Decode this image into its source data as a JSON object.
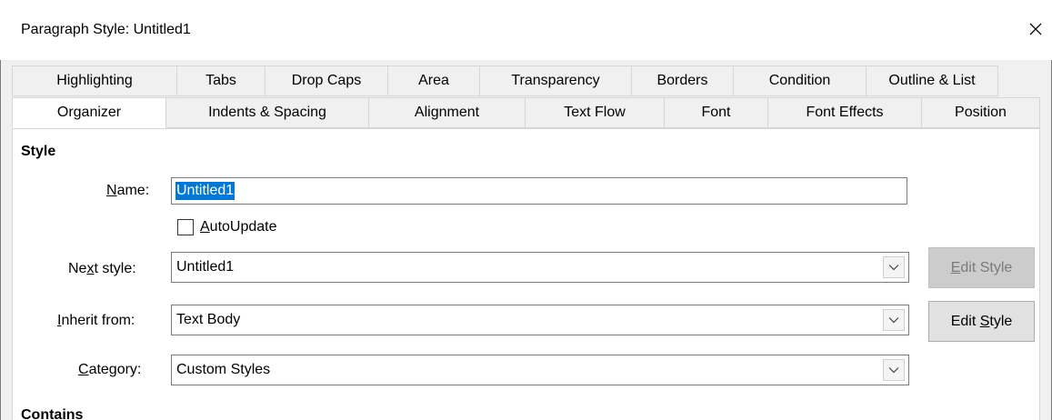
{
  "window": {
    "title": "Paragraph Style: Untitled1",
    "close_glyph": "close-icon"
  },
  "tabs": {
    "row1": [
      "Highlighting",
      "Tabs",
      "Drop Caps",
      "Area",
      "Transparency",
      "Borders",
      "Condition",
      "Outline & List"
    ],
    "row2": [
      "Organizer",
      "Indents & Spacing",
      "Alignment",
      "Text Flow",
      "Font",
      "Font Effects",
      "Position"
    ],
    "active": "Organizer"
  },
  "style_section": {
    "heading": "Style",
    "name_label_pre": "",
    "name_label_u": "N",
    "name_label_post": "ame:",
    "name_value": "Untitled1",
    "autoupdate_u": "A",
    "autoupdate_post": "utoUpdate",
    "autoupdate_checked": false,
    "next_style_label_pre": "Ne",
    "next_style_label_u": "x",
    "next_style_label_post": "t style:",
    "next_style_value": "Untitled1",
    "inherit_label_u": "I",
    "inherit_label_post": "nherit from:",
    "inherit_value": "Text Body",
    "category_label_u": "C",
    "category_label_post": "ategory:",
    "category_value": "Custom Styles",
    "edit_style_1_u": "E",
    "edit_style_1_post": "dit Style",
    "edit_style_2_pre": "Edit ",
    "edit_style_2_u": "S",
    "edit_style_2_post": "tyle"
  },
  "contains_section": {
    "heading": "Contains"
  },
  "colors": {
    "selection": "#0078d7",
    "dialog_bg": "#f0f0f0",
    "disabled_button": "#cccccc"
  }
}
